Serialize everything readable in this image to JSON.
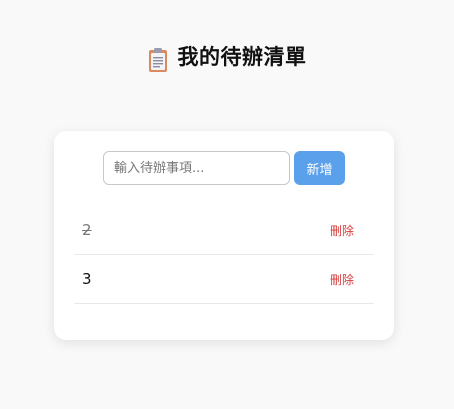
{
  "header": {
    "icon": "clipboard-icon",
    "title": "我的待辦清單"
  },
  "form": {
    "placeholder": "輸入待辦事項...",
    "value": "",
    "add_label": "新增"
  },
  "todos": [
    {
      "text": "2",
      "done": true,
      "delete_label": "刪除"
    },
    {
      "text": "3",
      "done": false,
      "delete_label": "刪除"
    }
  ],
  "colors": {
    "accent": "#5ba0ea",
    "danger": "#d43a3a",
    "background": "#f9f9f9"
  }
}
